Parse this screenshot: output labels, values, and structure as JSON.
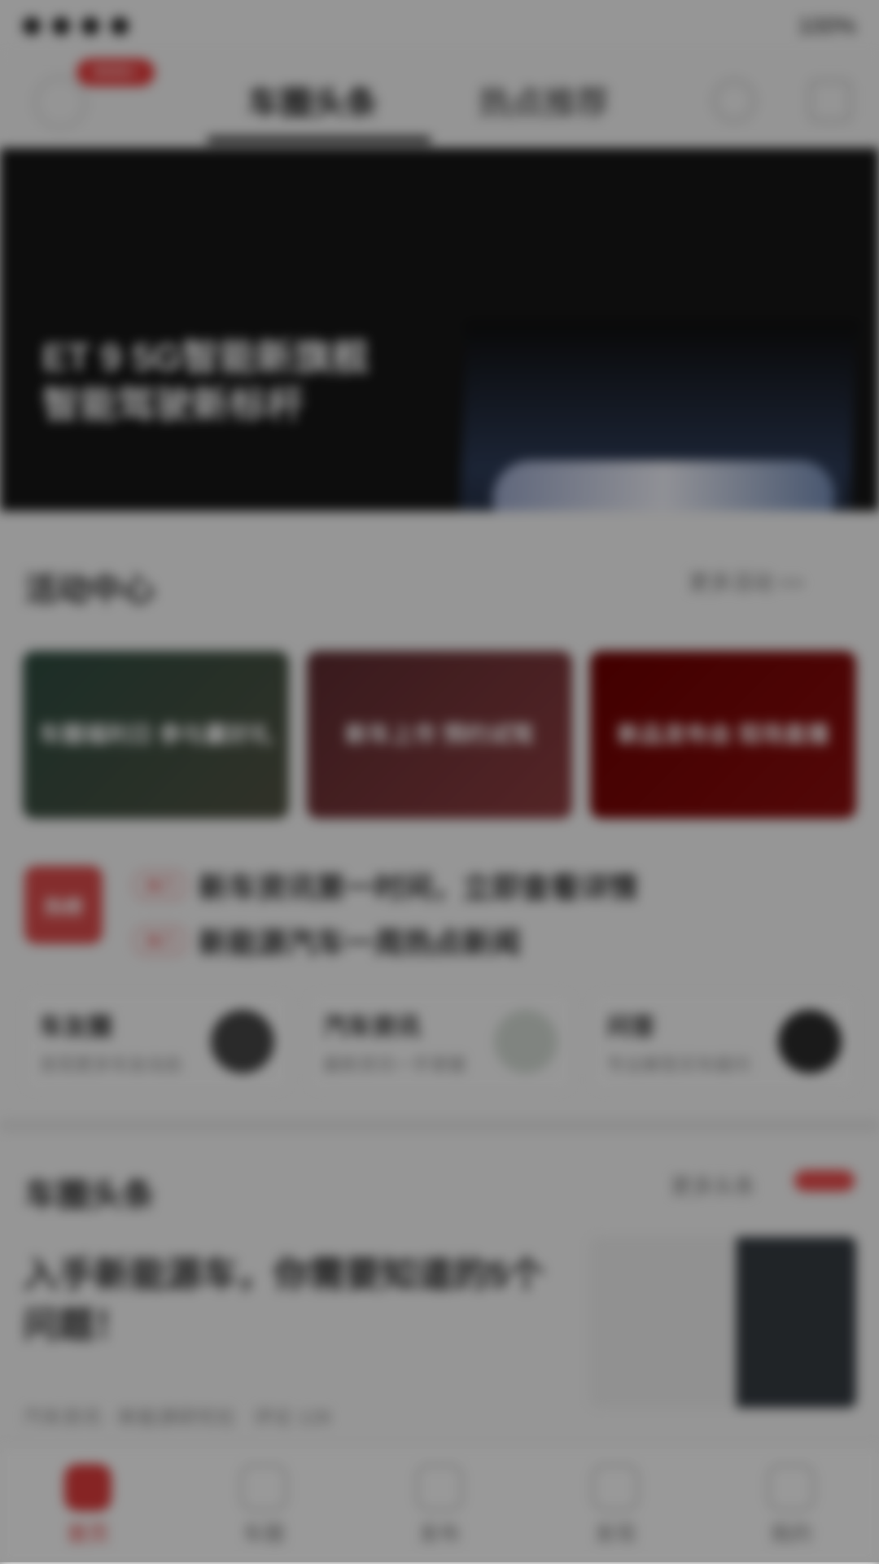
{
  "status": {
    "left_icons": [
      "signal",
      "wifi",
      "notif",
      "notif"
    ],
    "right": "100%"
  },
  "top_nav": {
    "badge": "9999+",
    "tabs": [
      "车圈头条",
      "热点推荐"
    ],
    "active_tab_index": 0,
    "icons": [
      "bell-icon",
      "message-icon"
    ]
  },
  "hero": {
    "title": "ET 9 5G智能新旗舰 智能驾驶新标杆"
  },
  "activity": {
    "title": "活动中心",
    "more": "更多活动 >>",
    "cards": [
      "车圈福利日 参与赢好礼",
      "新车上市 预约试驾",
      "新品发布会 现场直播"
    ]
  },
  "hot": {
    "icon_text": "热榜",
    "items": [
      {
        "tag": "热门",
        "text": "新车资讯第一时间，立即查看详情"
      },
      {
        "tag": "热门",
        "text": "新能源汽车一周热点新闻"
      }
    ]
  },
  "channels": [
    {
      "title": "车友圈",
      "subtitle": "发现更多车友动态"
    },
    {
      "title": "汽车资讯",
      "subtitle": "最新资讯一手掌握"
    },
    {
      "title": "问答",
      "subtitle": "专业解答买车疑问"
    }
  ],
  "news": {
    "title": "车圈头条",
    "more": "更多头条",
    "article": {
      "title": "入手新能源车，你需要知道的5个问题！",
      "meta_left": "汽车资讯 · 新能源研究社",
      "meta_right": "评论 128"
    }
  },
  "bottom_nav": {
    "items": [
      {
        "label": "首页",
        "icon": "home-icon",
        "active": true
      },
      {
        "label": "车圈",
        "icon": "circle-icon",
        "active": false
      },
      {
        "label": "发布",
        "icon": "publish-icon",
        "active": false
      },
      {
        "label": "发现",
        "icon": "discover-icon",
        "active": false
      },
      {
        "label": "我的",
        "icon": "profile-icon",
        "active": false
      }
    ]
  }
}
